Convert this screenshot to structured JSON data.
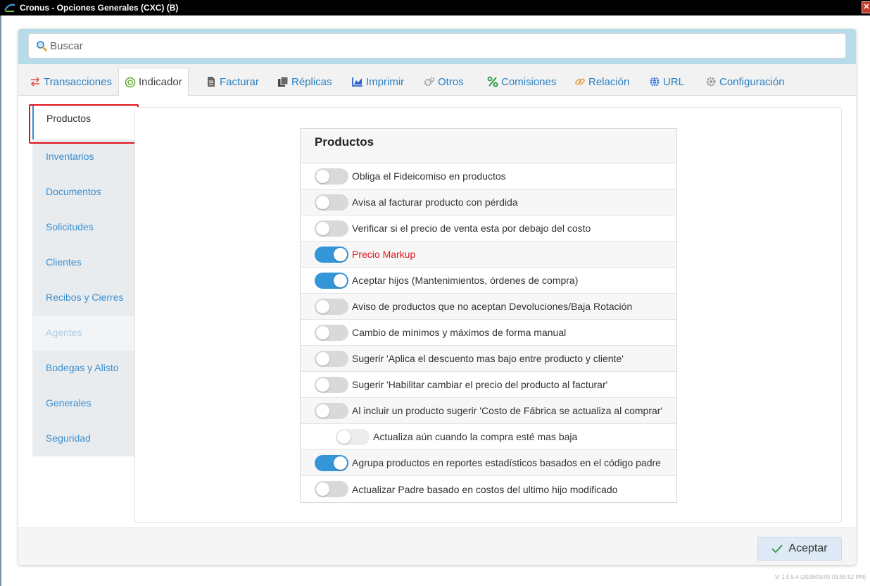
{
  "window": {
    "title": "Cronus - Opciones Generales (CXC) (B)",
    "close_glyph": "✕"
  },
  "search": {
    "placeholder": "Buscar",
    "value": ""
  },
  "tabs": [
    {
      "label": "Transacciones",
      "icon": "transfer-icon",
      "active": false
    },
    {
      "label": "Indicador",
      "icon": "target-icon",
      "active": true
    },
    {
      "label": "Facturar",
      "icon": "document-icon",
      "active": false
    },
    {
      "label": "Réplicas",
      "icon": "copy-icon",
      "active": false
    },
    {
      "label": "Imprimir",
      "icon": "chart-icon",
      "active": false
    },
    {
      "label": "Otros",
      "icon": "gears-icon",
      "active": false
    },
    {
      "label": "Comisiones",
      "icon": "percent-icon",
      "active": false
    },
    {
      "label": "Relación",
      "icon": "link-icon",
      "active": false
    },
    {
      "label": "URL",
      "icon": "globe-icon",
      "active": false
    },
    {
      "label": "Configuración",
      "icon": "gear-icon",
      "active": false
    }
  ],
  "sidebar": {
    "items": [
      {
        "label": "Productos",
        "active": true
      },
      {
        "label": "Inventarios"
      },
      {
        "label": "Documentos"
      },
      {
        "label": "Solicitudes"
      },
      {
        "label": "Clientes"
      },
      {
        "label": "Recibos y Cierres"
      },
      {
        "label": "Agentes",
        "disabled": true
      },
      {
        "label": "Bodegas y Alisto"
      },
      {
        "label": "Generales"
      },
      {
        "label": "Seguridad"
      }
    ]
  },
  "card": {
    "title": "Productos",
    "options": [
      {
        "label": "Obliga el Fideicomiso en productos",
        "on": false
      },
      {
        "label": "Avisa al facturar producto con pérdida",
        "on": false
      },
      {
        "label": "Verificar si el precio de venta esta por debajo del costo",
        "on": false
      },
      {
        "label": "Precio Markup",
        "on": true,
        "highlight": true
      },
      {
        "label": "Aceptar hijos (Mantenimientos, órdenes de compra)",
        "on": true
      },
      {
        "label": "Aviso de productos que no aceptan Devoluciones/Baja Rotación",
        "on": false
      },
      {
        "label": "Cambio de mínimos y máximos de forma manual",
        "on": false
      },
      {
        "label": "Sugerir 'Aplica el descuento mas bajo entre producto y cliente'",
        "on": false
      },
      {
        "label": "Sugerir 'Habilitar cambiar el precio del producto al facturar'",
        "on": false
      },
      {
        "label": "Al incluir un producto sugerir 'Costo de Fábrica se actualiza al comprar'",
        "on": false
      },
      {
        "label": "Actualiza aún cuando la compra esté mas baja",
        "on": false,
        "sub": true,
        "disabled": true
      },
      {
        "label": "Agrupa productos en reportes estadísticos basados en el código padre",
        "on": true
      },
      {
        "label": "Actualizar Padre basado en costos del ultimo hijo modificado",
        "on": false
      }
    ]
  },
  "footer": {
    "accept_label": "Aceptar",
    "version": "V: 1.0.5.4 (2026/09/05 03:55:52 PM)"
  },
  "colors": {
    "accent": "#3595d9",
    "link": "#2a7fc0",
    "highlight_red": "#e0121b",
    "search_band": "#b8dbe9"
  }
}
